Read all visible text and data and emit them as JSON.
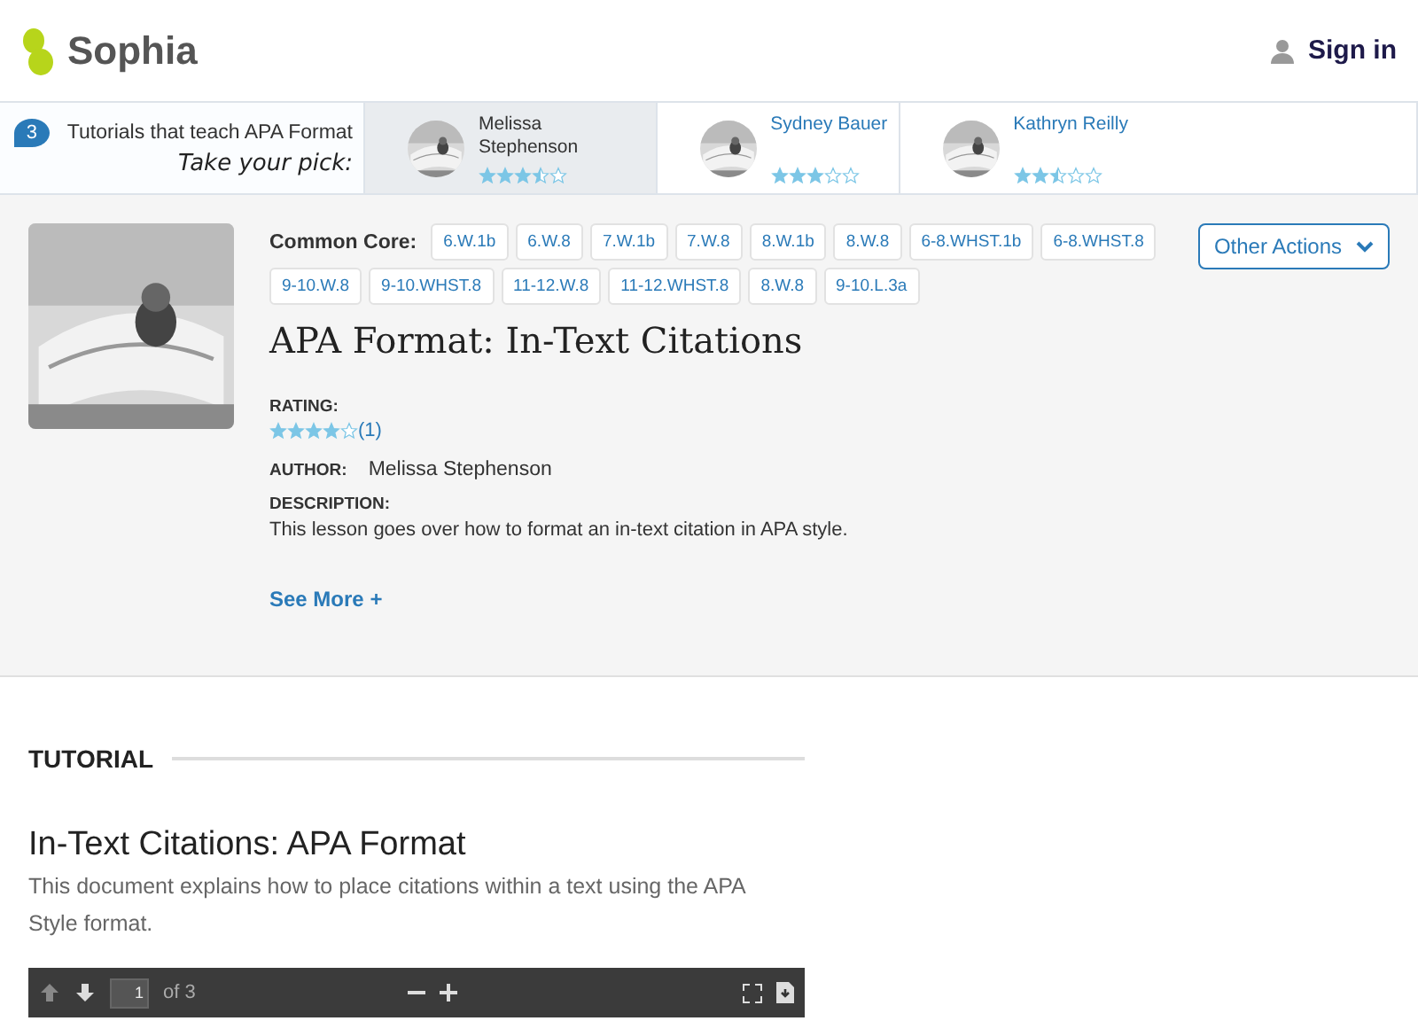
{
  "header": {
    "logo": "Sophia",
    "sign_in": "Sign in"
  },
  "tutorials_strip": {
    "count": "3",
    "title": "Tutorials that teach APA Format",
    "subtitle": "Take your pick:",
    "items": [
      {
        "author": "Melissa Stephenson",
        "stars": 3.5,
        "selected": true
      },
      {
        "author": "Sydney Bauer",
        "stars": 3,
        "selected": false
      },
      {
        "author": "Kathryn Reilly",
        "stars": 2.5,
        "selected": false
      }
    ]
  },
  "lesson": {
    "common_core_label": "Common Core:",
    "standards": [
      "6.W.1b",
      "6.W.8",
      "7.W.1b",
      "7.W.8",
      "8.W.1b",
      "8.W.8",
      "6-8.WHST.1b",
      "6-8.WHST.8",
      "9-10.W.8",
      "9-10.WHST.8",
      "11-12.W.8",
      "11-12.WHST.8",
      "8.W.8",
      "9-10.L.3a"
    ],
    "other_actions": "Other Actions",
    "title": "APA Format: In-Text Citations",
    "rating_label": "RATING:",
    "stars": 4,
    "rating_count": "(1)",
    "author_label": "AUTHOR:",
    "author": "Melissa Stephenson",
    "description_label": "DESCRIPTION:",
    "description": "This lesson goes over how to format an in-text citation in APA style.",
    "see_more": "See More +"
  },
  "tutorial": {
    "section_label": "TUTORIAL",
    "heading": "In-Text Citations: APA Format",
    "summary": "This document explains how to place citations within a text using the APA Style format.",
    "viewer": {
      "page": "1",
      "of": "of 3"
    }
  }
}
